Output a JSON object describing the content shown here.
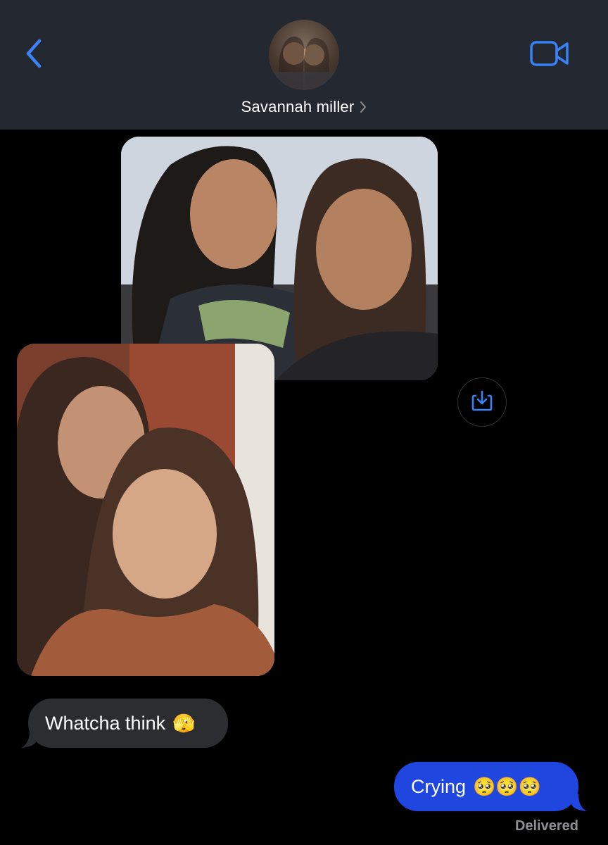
{
  "header": {
    "contact_name": "Savannah miller",
    "back_icon": "chevron-left-icon",
    "video_icon": "video-camera-icon",
    "accent_color": "#3b82f6"
  },
  "messages": [
    {
      "type": "photo",
      "direction": "received"
    },
    {
      "type": "photo",
      "direction": "received"
    },
    {
      "type": "text",
      "direction": "received",
      "text": "Whatcha think",
      "emoji": "🫣"
    },
    {
      "type": "text",
      "direction": "sent",
      "text": "Crying",
      "emoji": "🥺🥺🥺"
    }
  ],
  "received_text": "Whatcha think",
  "received_emoji": "🫣",
  "sent_text": "Crying",
  "sent_emoji": "🥺🥺🥺",
  "status": "Delivered",
  "colors": {
    "header_bg": "#232831",
    "received_bubble": "#2c2d31",
    "sent_bubble": "#1f47e0",
    "status_text": "#8e8e93"
  }
}
